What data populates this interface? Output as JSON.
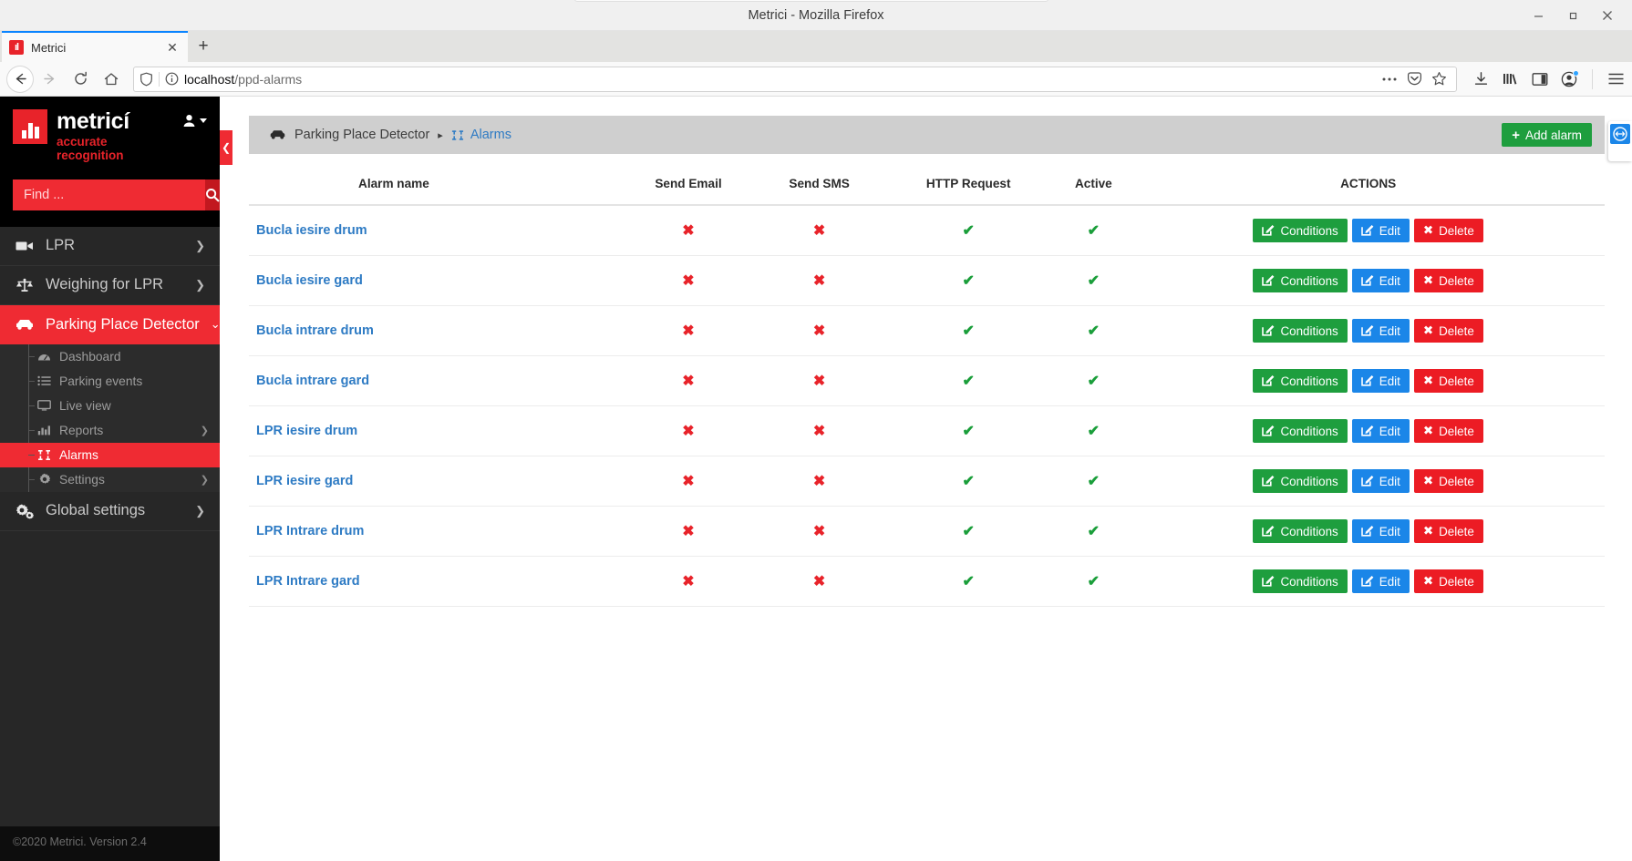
{
  "browser": {
    "window_title": "Metrici - Mozilla Firefox",
    "tab": {
      "title": "Metrici",
      "favicon_label": "ıl",
      "close_label": "✕"
    },
    "new_tab_label": "+",
    "url": {
      "prefix": "localhost",
      "suffix": "/ppd-alarms"
    },
    "window_controls": {
      "minimize": "–",
      "maximize": "□",
      "close": "✕"
    }
  },
  "sidebar": {
    "brand": {
      "name": "metricí",
      "tagline": "accurate recognition"
    },
    "search": {
      "placeholder": "Find ...",
      "value": ""
    },
    "nav": [
      {
        "label": "LPR",
        "icon": "video-camera-icon",
        "chevron": "❯",
        "active": false
      },
      {
        "label": "Weighing for LPR",
        "icon": "scales-icon",
        "chevron": "❯",
        "active": false
      },
      {
        "label": "Parking Place Detector",
        "icon": "car-icon",
        "chevron": "⌄",
        "active": true
      }
    ],
    "subnav": [
      {
        "label": "Dashboard",
        "icon": "gauge-icon",
        "chevron": "",
        "active": false
      },
      {
        "label": "Parking events",
        "icon": "list-icon",
        "chevron": "",
        "active": false
      },
      {
        "label": "Live view",
        "icon": "monitor-icon",
        "chevron": "",
        "active": false
      },
      {
        "label": "Reports",
        "icon": "bar-chart-icon",
        "chevron": "❯",
        "active": false
      },
      {
        "label": "Alarms",
        "icon": "alarms-icon",
        "chevron": "",
        "active": true
      },
      {
        "label": "Settings",
        "icon": "gear-icon",
        "chevron": "❯",
        "active": false
      }
    ],
    "global": {
      "label": "Global settings",
      "icon": "gears-icon",
      "chevron": "❯"
    },
    "copyright": "©2020 Metrici. Version 2.4",
    "collapse_label": "❮"
  },
  "breadcrumb": {
    "parent": "Parking Place Detector",
    "separator": "▸",
    "current": "Alarms",
    "add_button": {
      "label": "Add alarm",
      "plus": "+"
    }
  },
  "table": {
    "headers": [
      "Alarm name",
      "Send Email",
      "Send SMS",
      "HTTP Request",
      "Active",
      "ACTIONS"
    ],
    "marks": {
      "yes": "✔",
      "no": "✖"
    },
    "action_labels": {
      "conditions": "Conditions",
      "edit": "Edit",
      "delete": "Delete"
    },
    "rows": [
      {
        "name": "Bucla iesire drum",
        "send_email": false,
        "send_sms": false,
        "http_request": true,
        "active": true
      },
      {
        "name": "Bucla iesire gard",
        "send_email": false,
        "send_sms": false,
        "http_request": true,
        "active": true
      },
      {
        "name": "Bucla intrare drum",
        "send_email": false,
        "send_sms": false,
        "http_request": true,
        "active": true
      },
      {
        "name": "Bucla intrare gard",
        "send_email": false,
        "send_sms": false,
        "http_request": true,
        "active": true
      },
      {
        "name": "LPR iesire drum",
        "send_email": false,
        "send_sms": false,
        "http_request": true,
        "active": true
      },
      {
        "name": "LPR iesire gard",
        "send_email": false,
        "send_sms": false,
        "http_request": true,
        "active": true
      },
      {
        "name": "LPR Intrare drum",
        "send_email": false,
        "send_sms": false,
        "http_request": true,
        "active": true
      },
      {
        "name": "LPR Intrare gard",
        "send_email": false,
        "send_sms": false,
        "http_request": true,
        "active": true
      }
    ]
  },
  "colors": {
    "brand_red": "#e8232a",
    "sidebar_dark": "#272727",
    "link_blue": "#2e7bc4",
    "green": "#1e9e3e",
    "blue": "#1b86e8",
    "red": "#ec1c24"
  }
}
